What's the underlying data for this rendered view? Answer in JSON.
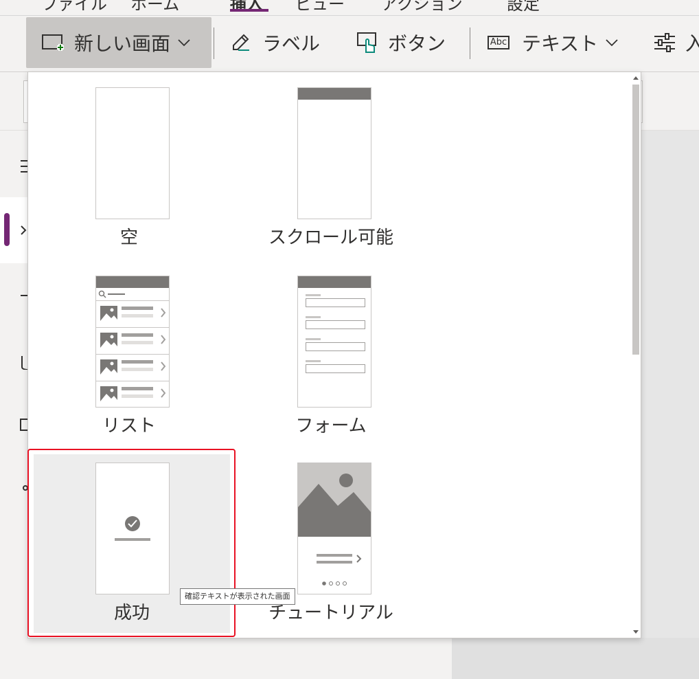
{
  "menu": {
    "tabs": [
      "ファイル",
      "ホーム",
      "挿入",
      "ビュー",
      "アクション",
      "設定"
    ],
    "active_tab": "挿入"
  },
  "ribbon": {
    "new_screen": "新しい画面",
    "label": "ラベル",
    "button": "ボタン",
    "text": "テキスト",
    "text_icon": "Abc",
    "input": "入"
  },
  "dropdown": {
    "templates": [
      {
        "label": "空"
      },
      {
        "label": "スクロール可能"
      },
      {
        "label": "リスト"
      },
      {
        "label": "フォーム"
      },
      {
        "label": "成功"
      },
      {
        "label": "チュートリアル"
      }
    ],
    "selected": "成功",
    "tooltip": "確認テキストが表示された画面"
  },
  "colors": {
    "accent": "#742774",
    "highlight": "#e81123",
    "ribbon_bg": "#f3f2f1"
  }
}
